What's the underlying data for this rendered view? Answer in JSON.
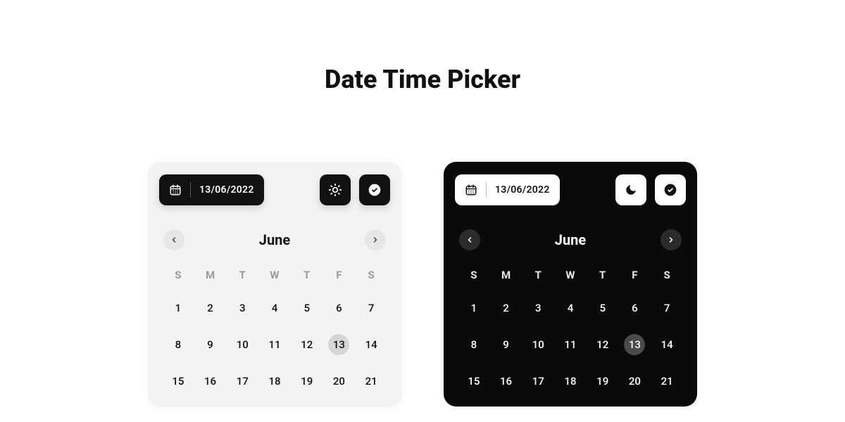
{
  "title": "Date Time Picker",
  "days_of_week": [
    "S",
    "M",
    "T",
    "W",
    "T",
    "F",
    "S"
  ],
  "light": {
    "date_value": "13/06/2022",
    "month": "June",
    "theme_icon": "sun",
    "selected_day": 13,
    "days": [
      1,
      2,
      3,
      4,
      5,
      6,
      7,
      8,
      9,
      10,
      11,
      12,
      13,
      14,
      15,
      16,
      17,
      18,
      19,
      20,
      21
    ]
  },
  "dark": {
    "date_value": "13/06/2022",
    "month": "June",
    "theme_icon": "moon",
    "selected_day": 13,
    "days": [
      1,
      2,
      3,
      4,
      5,
      6,
      7,
      8,
      9,
      10,
      11,
      12,
      13,
      14,
      15,
      16,
      17,
      18,
      19,
      20,
      21
    ]
  },
  "icons": {
    "calendar": "calendar-icon",
    "sun": "sun-icon",
    "moon": "moon-icon",
    "check": "check-circle-icon",
    "prev": "chevron-left-icon",
    "next": "chevron-right-icon"
  }
}
